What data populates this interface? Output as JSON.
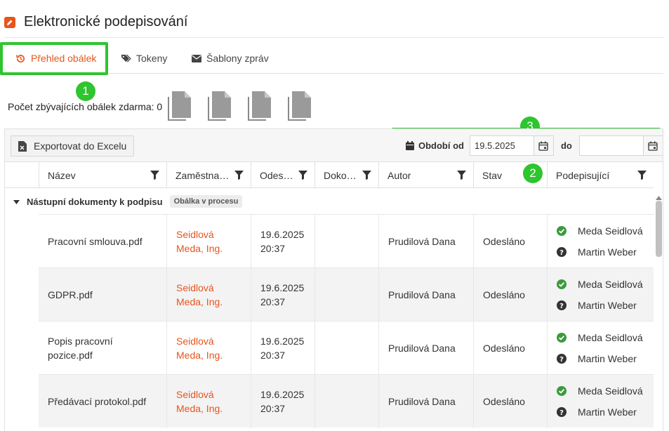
{
  "page": {
    "title": "Elektronické podepisování"
  },
  "tabs": [
    {
      "label": "Přehled obálek",
      "icon": "history-icon",
      "active": true
    },
    {
      "label": "Tokeny",
      "icon": "tag-icon",
      "active": false
    },
    {
      "label": "Šablony zpráv",
      "icon": "envelope-icon",
      "active": false
    }
  ],
  "markers": [
    "1",
    "2",
    "3"
  ],
  "free_envelopes": {
    "label": "Počet zbývajících obálek zdarma: 0",
    "icon_count": 4
  },
  "toolbar": {
    "export_label": "Exportovat do Excelu",
    "period_from_label": "Období od",
    "period_from_value": "19.5.2025",
    "period_to_label": "do",
    "period_to_value": ""
  },
  "columns": [
    "Název",
    "Zaměstna…",
    "Odes…",
    "Doko…",
    "Autor",
    "Stav",
    "Podepisující"
  ],
  "group": {
    "title": "Nástupní dokumenty k podpisu",
    "badge": "Obálka v procesu"
  },
  "rows": [
    {
      "name": "Pracovní smlouva.pdf",
      "employee": "Seidlová Meda, Ing.",
      "sent": "19.6.2025 20:37",
      "completed": "",
      "author": "Prudilová Dana",
      "status": "Odesláno",
      "signers": [
        {
          "name": "Meda Seidlová",
          "state": "signed"
        },
        {
          "name": "Martin Weber",
          "state": "pending"
        }
      ]
    },
    {
      "name": "GDPR.pdf",
      "employee": "Seidlová Meda, Ing.",
      "sent": "19.6.2025 20:37",
      "completed": "",
      "author": "Prudilová Dana",
      "status": "Odesláno",
      "signers": [
        {
          "name": "Meda Seidlová",
          "state": "signed"
        },
        {
          "name": "Martin Weber",
          "state": "pending"
        }
      ]
    },
    {
      "name": "Popis pracovní pozice.pdf",
      "employee": "Seidlová Meda, Ing.",
      "sent": "19.6.2025 20:37",
      "completed": "",
      "author": "Prudilová Dana",
      "status": "Odesláno",
      "signers": [
        {
          "name": "Meda Seidlová",
          "state": "signed"
        },
        {
          "name": "Martin Weber",
          "state": "pending"
        }
      ]
    },
    {
      "name": "Předávací protokol.pdf",
      "employee": "Seidlová Meda, Ing.",
      "sent": "19.6.2025 20:37",
      "completed": "",
      "author": "Prudilová Dana",
      "status": "Odesláno",
      "signers": [
        {
          "name": "Meda Seidlová",
          "state": "signed"
        },
        {
          "name": "Martin Weber",
          "state": "pending"
        }
      ]
    }
  ],
  "colors": {
    "accent": "#e8541c",
    "highlight": "#2ec52e",
    "signed": "#3c9a3c",
    "pending": "#333333"
  }
}
